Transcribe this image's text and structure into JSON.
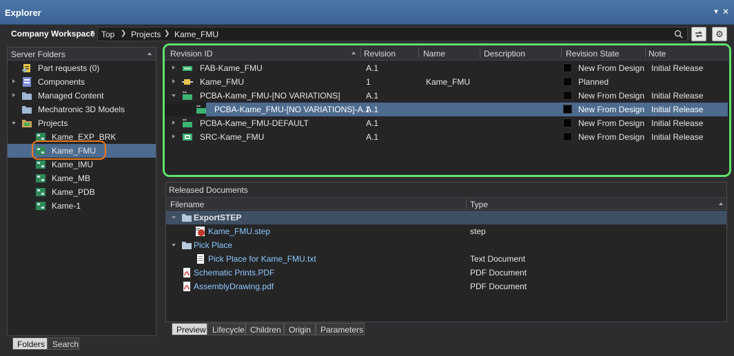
{
  "window": {
    "title": "Explorer"
  },
  "nav": {
    "workspace": "Company Workspace",
    "breadcrumbs": [
      "Top",
      "Projects",
      "Kame_FMU"
    ]
  },
  "left_panel": {
    "header": "Server Folders",
    "items": [
      {
        "label": "Part requests (0)",
        "icon": "part-requests-icon"
      },
      {
        "label": "Components",
        "icon": "components-icon"
      },
      {
        "label": "Managed Content",
        "icon": "folder-icon"
      },
      {
        "label": "Mechatronic 3D Models",
        "icon": "folder-icon"
      },
      {
        "label": "Projects",
        "icon": "projects-icon"
      },
      {
        "label": "Kame_EXP_BRK",
        "icon": "project-icon"
      },
      {
        "label": "Kame_FMU",
        "icon": "project-icon"
      },
      {
        "label": "Kame_IMU",
        "icon": "project-icon"
      },
      {
        "label": "Kame_MB",
        "icon": "project-icon"
      },
      {
        "label": "Kame_PDB",
        "icon": "project-icon"
      },
      {
        "label": "Kame-1",
        "icon": "project-icon"
      }
    ],
    "tabs": [
      "Folders",
      "Search"
    ]
  },
  "revisions": {
    "columns": [
      "Revision ID",
      "Revision",
      "Name",
      "Description",
      "Revision State",
      "Note"
    ],
    "rows": [
      {
        "id": "FAB-Kame_FMU",
        "revision": "A.1",
        "name": "",
        "state": "New From Design",
        "note": "Initial Release"
      },
      {
        "id": "Kame_FMU",
        "revision": "1",
        "name": "Kame_FMU",
        "state": "Planned",
        "note": ""
      },
      {
        "id": "PCBA-Kame_FMU-[NO VARIATIONS]",
        "revision": "A.1",
        "name": "",
        "state": "New From Design",
        "note": "Initial Release"
      },
      {
        "id": "PCBA-Kame_FMU-[NO VARIATIONS]-A.1",
        "revision": "A.1",
        "name": "",
        "state": "New From Design",
        "note": "Initial Release"
      },
      {
        "id": "PCBA-Kame_FMU-DEFAULT",
        "revision": "A.1",
        "name": "",
        "state": "New From Design",
        "note": "Initial Release"
      },
      {
        "id": "SRC-Kame_FMU",
        "revision": "A.1",
        "name": "",
        "state": "New From Design",
        "note": "Initial Release"
      }
    ]
  },
  "documents": {
    "title": "Released Documents",
    "columns": [
      "Filename",
      "Type"
    ],
    "rows": [
      {
        "name": "ExportSTEP",
        "type": ""
      },
      {
        "name": "Kame_FMU.step",
        "type": "step"
      },
      {
        "name": "Pick Place",
        "type": ""
      },
      {
        "name": "Pick Place for Kame_FMU.txt",
        "type": "Text Document"
      },
      {
        "name": "Schematic Prints.PDF",
        "type": "PDF Document"
      },
      {
        "name": "AssemblyDrawing.pdf",
        "type": "PDF Document"
      }
    ],
    "tabs": [
      "Preview",
      "Lifecycle",
      "Children",
      "Origin",
      "Parameters"
    ]
  },
  "colors": {
    "selection": "#4d6b8f",
    "highlight_ring": "#f07a1c",
    "panel_outline": "#5ee36b"
  }
}
